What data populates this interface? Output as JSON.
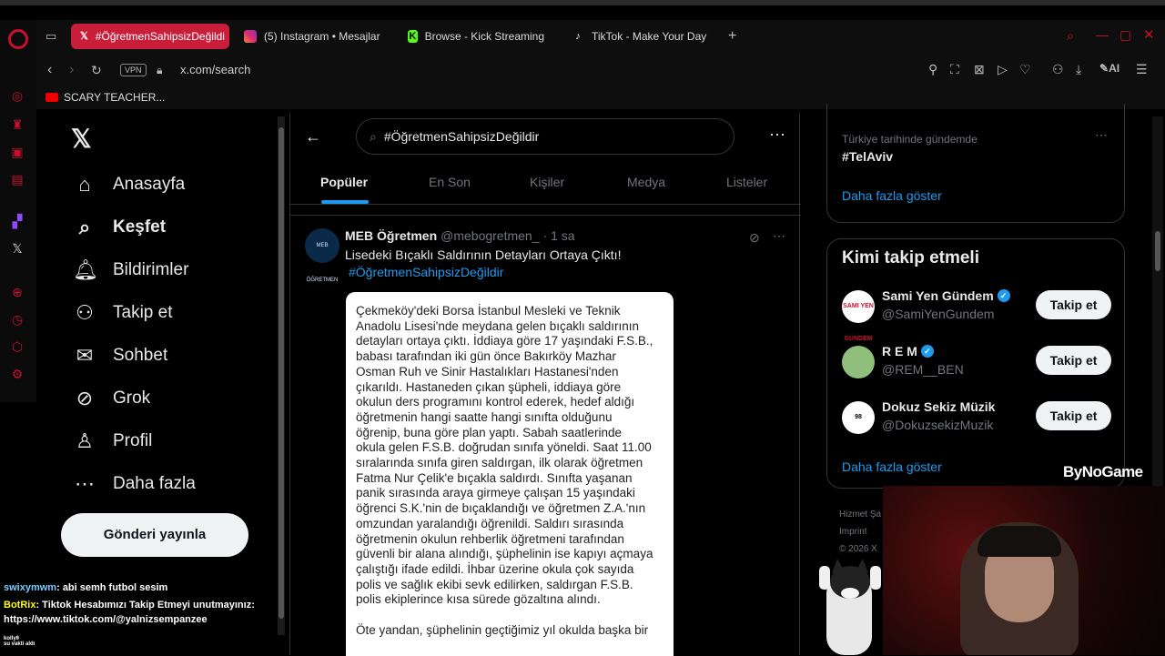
{
  "browser": {
    "tabs": [
      {
        "label": "#ÖğretmenSahipsizDeğildi",
        "icon": "x-logo-icon",
        "active": true
      },
      {
        "label": "(5) Instagram • Mesajlar",
        "icon": "instagram-icon",
        "active": false
      },
      {
        "label": "Browse - Kick Streaming",
        "icon": "kick-icon",
        "active": false
      },
      {
        "label": "TikTok - Make Your Day",
        "icon": "tiktok-icon",
        "active": false
      }
    ],
    "vpn_label": "VPN",
    "url": "x.com/search",
    "ai_label": "AI",
    "bookmark": "SCARY TEACHER..."
  },
  "x_nav": {
    "items": [
      {
        "label": "Anasayfa",
        "icon": "home-icon"
      },
      {
        "label": "Keşfet",
        "icon": "search-icon"
      },
      {
        "label": "Bildirimler",
        "icon": "bell-icon"
      },
      {
        "label": "Takip et",
        "icon": "add-person-icon"
      },
      {
        "label": "Sohbet",
        "icon": "mail-icon"
      },
      {
        "label": "Grok",
        "icon": "grok-icon"
      },
      {
        "label": "Profil",
        "icon": "person-icon"
      },
      {
        "label": "Daha fazla",
        "icon": "more-circle-icon"
      }
    ],
    "post_button": "Gönderi yayınla"
  },
  "search": {
    "query": "#ÖğretmenSahipsizDeğildir",
    "tabs": [
      "Popüler",
      "En Son",
      "Kişiler",
      "Medya",
      "Listeler"
    ]
  },
  "tweet": {
    "name": "MEB Öğretmen",
    "handle": "@mebogretmen_",
    "time": "· 1 sa",
    "title": "Lisedeki Bıçaklı Saldırının Detayları Ortaya Çıktı!",
    "hashtag": "#ÖğretmenSahipsizDeğildir",
    "avatar_text": "MEB ÖĞRETMEN",
    "doc_lines": [
      "Çekmeköy'deki Borsa İstanbul Mesleki ve Teknik",
      "Anadolu Lisesi'nde meydana gelen bıçaklı saldırının",
      "detayları ortaya çıktı. İddiaya göre 17 yaşındaki F.S.B.,",
      "babası tarafından iki gün önce Bakırköy Mazhar",
      "Osman Ruh ve Sinir Hastalıkları Hastanesi'nden",
      "çıkarıldı. Hastaneden çıkan şüpheli, iddiaya göre",
      "okulun ders programını kontrol ederek, hedef aldığı",
      "öğretmenin hangi saatte hangi sınıfta olduğunu",
      "öğrenip, buna göre plan yaptı. Sabah saatlerinde",
      "okula gelen F.S.B. doğrudan sınıfa yöneldi. Saat 11.00",
      "sıralarında sınıfa giren saldırgan, ilk olarak öğretmen",
      "Fatma Nur Çelik'e bıçakla saldırdı. Sınıfta yaşanan",
      "panik sırasında araya girmeye çalışan 15 yaşındaki",
      "öğrenci S.K.'nin de bıçaklandığı ve öğretmen Z.A.'nın",
      "omzundan yaralandığı öğrenildi. Saldırı sırasında",
      "öğretmenin okulun rehberlik öğretmeni tarafından",
      "güvenli bir alana alındığı, şüphelinin ise kapıyı açmaya",
      "çalıştığı ifade edildi. İhbar üzerine okula çok sayıda",
      "polis ve sağlık ekibi sevk edilirken, saldırgan F.S.B.",
      "polis ekiplerince kısa sürede gözaltına alındı."
    ],
    "doc_lines_2": [
      "Öte yandan, şüphelinin geçtiğimiz yıl okulda başka bir"
    ]
  },
  "trend": {
    "context": "Türkiye tarihinde gündemde",
    "tag": "#TelAviv",
    "show_more": "Daha fazla göster"
  },
  "who_to_follow": {
    "title": "Kimi takip etmeli",
    "items": [
      {
        "name": "Sami Yen Gündem",
        "handle": "@SamiYenGundem",
        "verified": true,
        "button": "Takip et",
        "avatar_text": "SAMI YEN GÜNDEM"
      },
      {
        "name": "R E M",
        "handle": "@REM__BEN",
        "verified": true,
        "button": "Takip et",
        "avatar_text": ""
      },
      {
        "name": "Dokuz Sekiz Müzik",
        "handle": "@DokuzsekizMuzik",
        "verified": false,
        "button": "Takip et",
        "avatar_text": "98"
      }
    ],
    "show_more": "Daha fazla göster"
  },
  "footer": [
    "Hizmet Şa",
    "Imprint",
    "© 2026 X"
  ],
  "overlay": {
    "brand": "ByNoGame",
    "chat": [
      {
        "user": "swixymwm",
        "text": ": abi semh futbol sesim"
      },
      {
        "user": "BotRix",
        "text": ": Tiktok Hesabımızı Takip Etmeyi unutmayınız:"
      },
      {
        "user": "",
        "text": "https://www.tiktok.com/@yalnizsempanzee"
      },
      {
        "user": "kollyθ",
        "text": "su vakti aldı"
      }
    ]
  },
  "colors": {
    "accent": "#1d9bf0",
    "opera_red": "#c81e3a",
    "bg": "#000000"
  }
}
